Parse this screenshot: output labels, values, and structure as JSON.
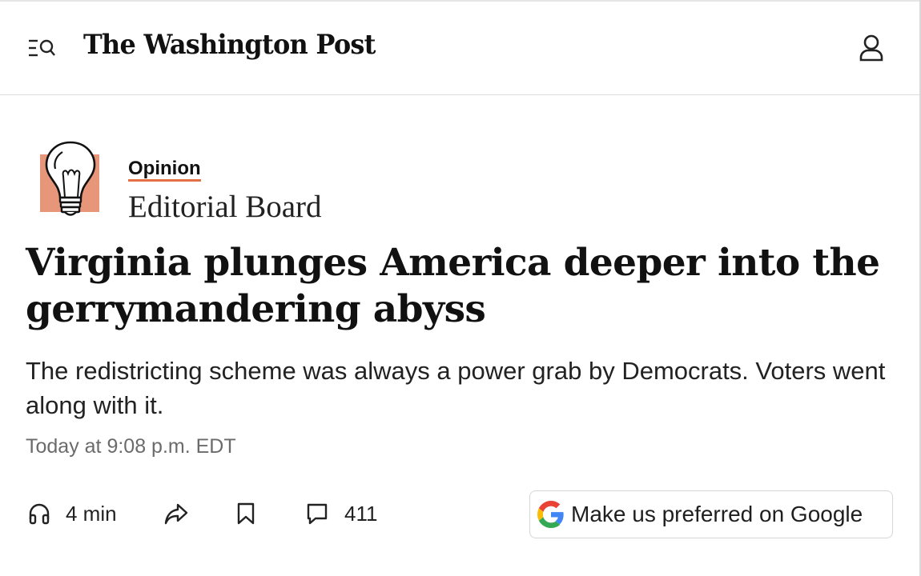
{
  "header": {
    "logo_text": "The Washington Post",
    "menu_icon": "menu-search-icon",
    "user_icon": "user-icon"
  },
  "article": {
    "section_label": "Opinion",
    "byline": "Editorial Board",
    "section_icon": "lightbulb-icon",
    "section_accent_color": "#e8967a",
    "link_underline_color": "#e36f45",
    "headline": "Virginia plunges America deeper into the gerrymandering abyss",
    "dek": "The redistricting scheme was always a power grab by Democrats. Voters went along with it.",
    "timestamp": "Today at 9:08 p.m. EDT"
  },
  "toolbar": {
    "listen_label": "4 min",
    "listen_icon": "headphones-icon",
    "share_icon": "share-icon",
    "save_icon": "bookmark-icon",
    "comments_count": "411",
    "comments_icon": "comment-icon",
    "google_button_label": "Make us preferred on Google",
    "google_icon": "google-g-icon"
  }
}
